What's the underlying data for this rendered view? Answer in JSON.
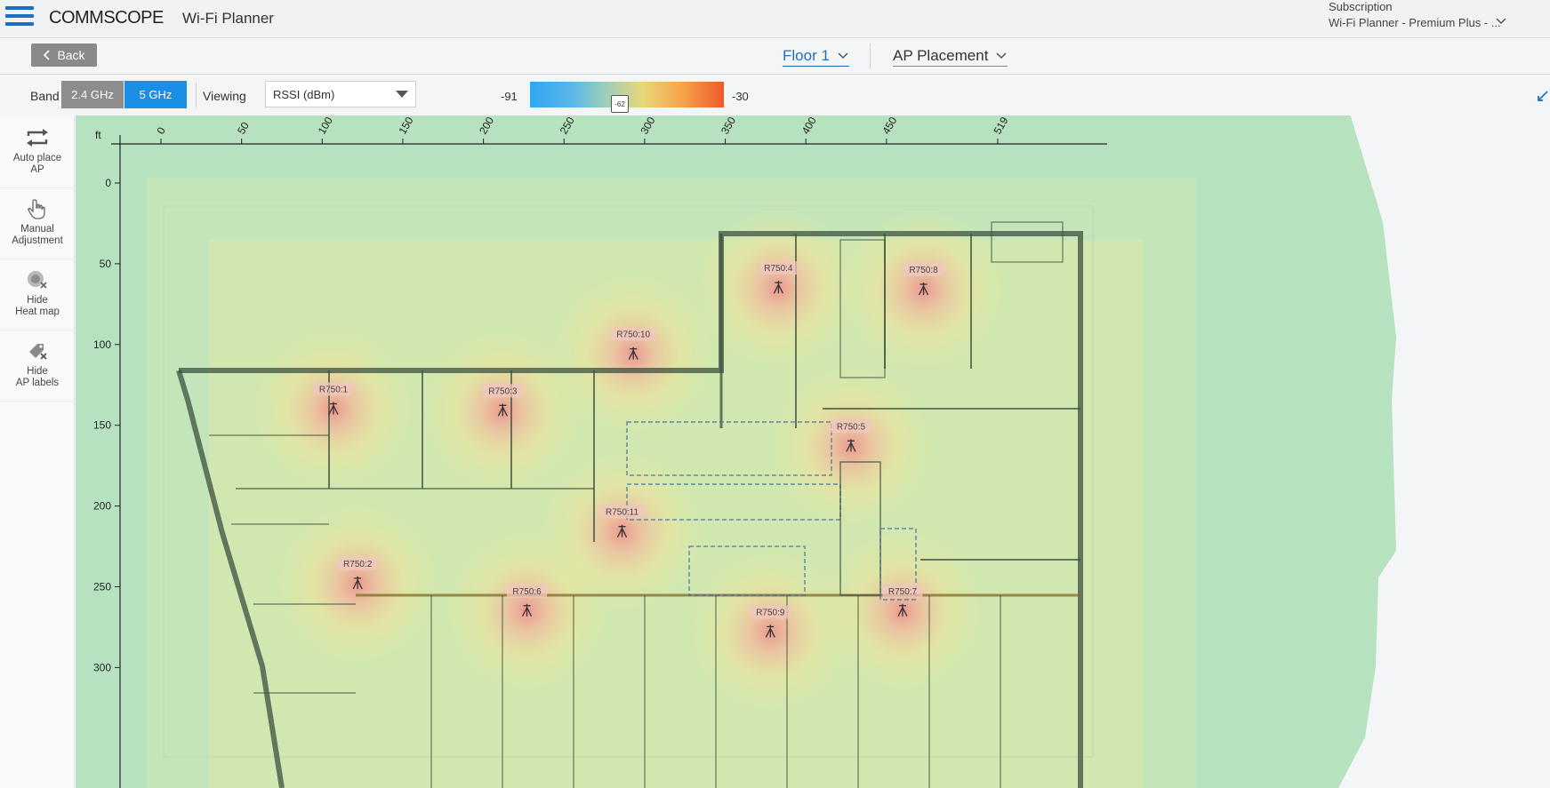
{
  "header": {
    "brand": "COMMSCOPE",
    "app_title": "Wi-Fi Planner",
    "subscription_label": "Subscription",
    "subscription_value": "Wi-Fi Planner - Premium Plus - ..."
  },
  "nav": {
    "back_label": "Back",
    "floor": "Floor 1",
    "mode": "AP Placement"
  },
  "toolbar": {
    "band_label": "Band",
    "band_24": "2.4 GHz",
    "band_5": "5 GHz",
    "band_selected": "5 GHz",
    "viewing_label": "Viewing",
    "viewing_value": "RSSI (dBm)",
    "scale_min": "-91",
    "scale_max": "-30",
    "scale_handle": "-62"
  },
  "tools": [
    {
      "label": "Auto place\nAP",
      "icon": "auto-place-icon"
    },
    {
      "label": "Manual\nAdjustment",
      "icon": "hand-pointer-icon"
    },
    {
      "label": "Hide\nHeat map",
      "icon": "heatmap-hide-icon"
    },
    {
      "label": "Hide\nAP labels",
      "icon": "tag-hide-icon"
    }
  ],
  "axes": {
    "unit": "ft",
    "x_ticks": [
      "0",
      "50",
      "100",
      "150",
      "200",
      "250",
      "300",
      "350",
      "400",
      "450",
      "519"
    ],
    "y_ticks": [
      "0",
      "50",
      "100",
      "150",
      "200",
      "250",
      "300"
    ]
  },
  "access_points": [
    {
      "name": "R750:1",
      "x": 107,
      "y": 140
    },
    {
      "name": "R750:2",
      "x": 122,
      "y": 248
    },
    {
      "name": "R750:3",
      "x": 212,
      "y": 141
    },
    {
      "name": "R750:4",
      "x": 383,
      "y": 65
    },
    {
      "name": "R750:5",
      "x": 428,
      "y": 163
    },
    {
      "name": "R750:6",
      "x": 227,
      "y": 265
    },
    {
      "name": "R750:7",
      "x": 460,
      "y": 265
    },
    {
      "name": "R750:8",
      "x": 473,
      "y": 66
    },
    {
      "name": "R750:9",
      "x": 378,
      "y": 278
    },
    {
      "name": "R750:10",
      "x": 293,
      "y": 106
    },
    {
      "name": "R750:11",
      "x": 286,
      "y": 216
    }
  ],
  "colors": {
    "accent": "#1f6fc1",
    "band_active": "#1b8fe6",
    "band_inactive": "#8d8d8d",
    "heat_low": "#a8ddb8",
    "heat_high": "#ee5a2b"
  }
}
